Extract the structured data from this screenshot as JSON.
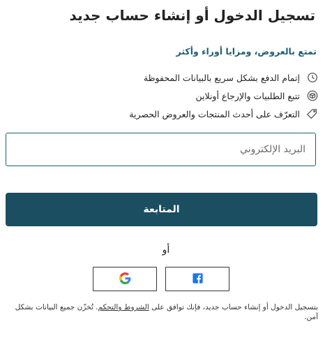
{
  "header": {
    "title": "تسجيل الدخول أو إنشاء حساب جديد"
  },
  "promo": {
    "subtitle": "تمتع بالعروض، ومزايا أوراء وأكثر",
    "benefits": [
      {
        "icon": "clock-icon",
        "text": "إتمام الدفع بشكل سريع بالبيانات المحفوظة"
      },
      {
        "icon": "package-icon",
        "text": "تتبع الطلبيات والإرجاع أونلاين"
      },
      {
        "icon": "tag-icon",
        "text": "التعرّف على أحدث المنتجات والعروض الحصرية"
      }
    ]
  },
  "form": {
    "email_placeholder": "البريد الإلكتروني",
    "continue_label": "المتابعة"
  },
  "social": {
    "or_label": "أو",
    "providers": [
      {
        "name": "google",
        "icon": "google-icon"
      },
      {
        "name": "facebook",
        "icon": "facebook-icon"
      }
    ],
    "colors": {
      "google_blue": "#4285F4",
      "google_red": "#EA4335",
      "google_yellow": "#FBBC05",
      "google_green": "#34A853",
      "facebook_blue": "#1877F2"
    }
  },
  "terms": {
    "prefix": "بتسجيل الدخول أو إنشاء حساب جديد، فإنك توافق على ",
    "link_text": "الشروط والتحكم",
    "suffix": ". تُخزّن جميع البيانات بشكل آمن."
  },
  "theme": {
    "primary": "#1b4e60",
    "accent_text": "#1e5f70"
  }
}
